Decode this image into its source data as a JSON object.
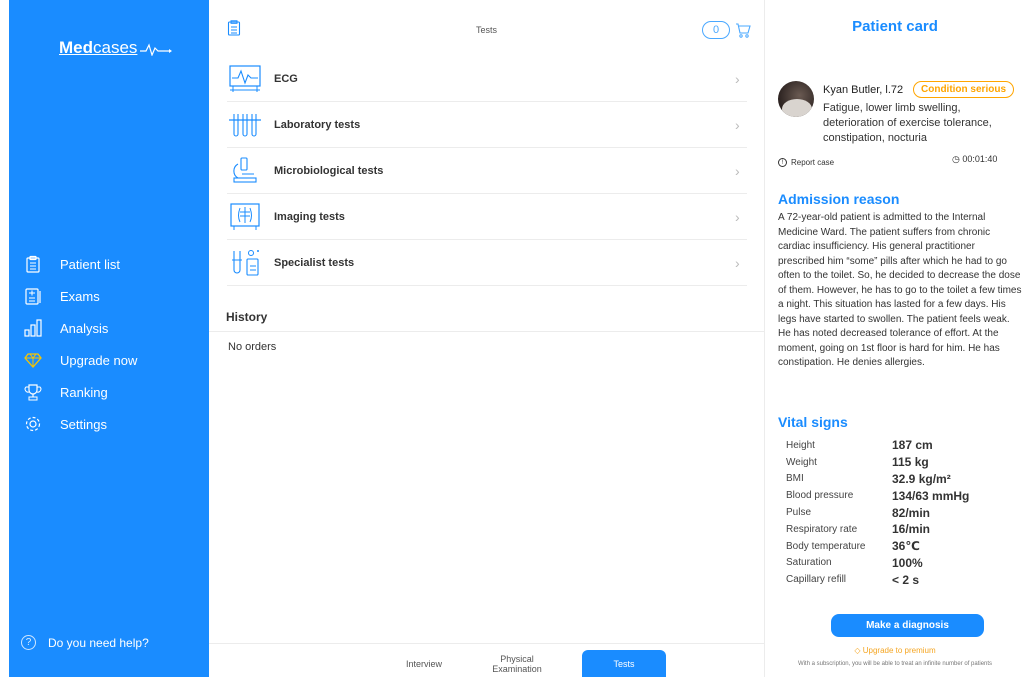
{
  "sidebar": {
    "logo_bold": "Med",
    "logo_rest": "cases",
    "items": [
      {
        "label": "Patient list",
        "icon": "clipboard-icon"
      },
      {
        "label": "Exams",
        "icon": "exam-icon"
      },
      {
        "label": "Analysis",
        "icon": "bar-chart-icon"
      },
      {
        "label": "Upgrade now",
        "icon": "diamond-icon"
      },
      {
        "label": "Ranking",
        "icon": "trophy-icon"
      },
      {
        "label": "Settings",
        "icon": "gear-icon"
      }
    ],
    "help": "Do you need help?"
  },
  "tests": {
    "title": "Tests",
    "cart_count": "0",
    "items": [
      {
        "label": "ECG",
        "icon": "ecg-icon"
      },
      {
        "label": "Laboratory tests",
        "icon": "test-tubes-icon"
      },
      {
        "label": "Microbiological tests",
        "icon": "microscope-icon"
      },
      {
        "label": "Imaging tests",
        "icon": "xray-icon"
      },
      {
        "label": "Specialist tests",
        "icon": "specialist-icon"
      }
    ],
    "history_title": "History",
    "history_empty": "No orders"
  },
  "bottom_tabs": [
    {
      "label": "Interview"
    },
    {
      "label": "Physical\nExamination"
    },
    {
      "label": "Tests"
    }
  ],
  "patient": {
    "card_title": "Patient card",
    "name": "Kyan Butler, l.72",
    "condition": "Condition serious",
    "symptoms": "Fatigue, lower limb swelling, deterioration of exercise tolerance, constipation, nocturia",
    "report": "Report case",
    "timer": "00:01:40",
    "admission_title": "Admission reason",
    "admission_text": "A 72-year-old patient is admitted to the Internal Medicine Ward. The patient suffers from chronic cardiac insufficiency. His general practitioner prescribed him “some” pills after which he had to go often to the toilet. So, he decided to decrease the dose of them. However, he has to go to the toilet a few times a night. This situation has lasted for a few days. His legs have started to swollen. The patient feels weak. He has noted decreased tolerance of effort. At the moment, going on 1st floor is hard for him. He has constipation. He denies allergies.",
    "vitals_title": "Vital signs",
    "vitals": [
      {
        "label": "Height",
        "value": "187 cm"
      },
      {
        "label": "Weight",
        "value": "115 kg"
      },
      {
        "label": "BMI",
        "value": "32.9 kg/m²"
      },
      {
        "label": "Blood pressure",
        "value": "134/63 mmHg"
      },
      {
        "label": "Pulse",
        "value": "82/min"
      },
      {
        "label": "Respiratory rate",
        "value": "16/min"
      },
      {
        "label": "Body temperature",
        "value": "36℃"
      },
      {
        "label": "Saturation",
        "value": "100%"
      },
      {
        "label": "Capillary refill",
        "value": "< 2 s"
      }
    ],
    "diagnosis_button": "Make a diagnosis",
    "upgrade_link": "Upgrade to premium",
    "subscription_note": "With a subscription, you will be able to treat an infinite number of patients"
  },
  "colors": {
    "accent": "#1a8cff",
    "warning": "#ffa500"
  }
}
